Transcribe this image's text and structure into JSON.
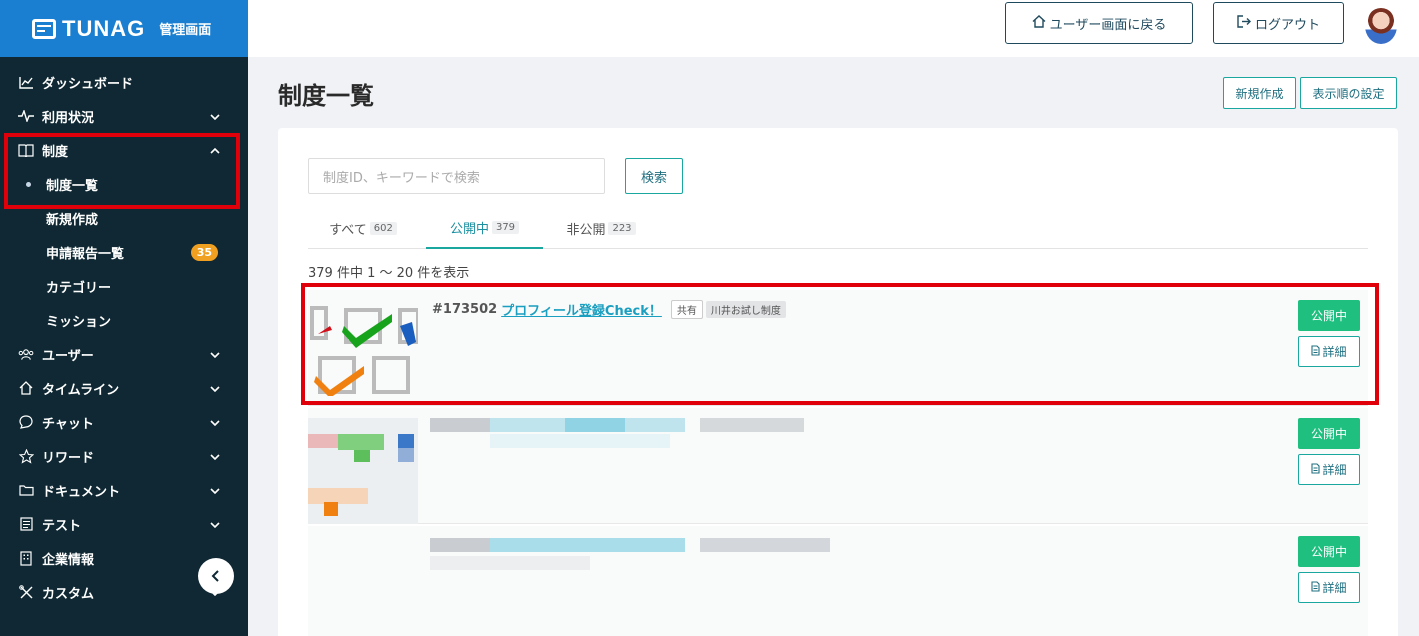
{
  "brand": {
    "name": "TUNAG",
    "sub": "管理画面"
  },
  "sidebar": {
    "items": [
      {
        "icon": "chart-icon",
        "glyph": "📈",
        "label": "ダッシュボード",
        "chevron": ""
      },
      {
        "icon": "activity-icon",
        "glyph": "∿",
        "label": "利用状況",
        "chevron": "⌄"
      },
      {
        "icon": "book-icon",
        "glyph": "📖",
        "label": "制度",
        "chevron": "⌃"
      }
    ],
    "sub_items": [
      {
        "label": "制度一覧",
        "active": true
      },
      {
        "label": "新規作成"
      },
      {
        "label": "申請報告一覧",
        "badge": "35"
      },
      {
        "label": "カテゴリー"
      },
      {
        "label": "ミッション"
      }
    ],
    "items_after": [
      {
        "icon": "users-icon",
        "glyph": "👥",
        "label": "ユーザー",
        "chevron": "⌄"
      },
      {
        "icon": "home-icon",
        "glyph": "⌂",
        "label": "タイムライン",
        "chevron": "⌄"
      },
      {
        "icon": "chat-icon",
        "glyph": "💬",
        "label": "チャット",
        "chevron": "⌄"
      },
      {
        "icon": "star-icon",
        "glyph": "☆",
        "label": "リワード",
        "chevron": "⌄"
      },
      {
        "icon": "folder-icon",
        "glyph": "🗀",
        "label": "ドキュメント",
        "chevron": "⌄"
      },
      {
        "icon": "test-icon",
        "glyph": "▤",
        "label": "テスト",
        "chevron": "⌄"
      },
      {
        "icon": "building-icon",
        "glyph": "▦",
        "label": "企業情報",
        "chevron": ""
      },
      {
        "icon": "tools-icon",
        "glyph": "✕",
        "label": "カスタム",
        "chevron": "⌄"
      }
    ],
    "collapse": "‹"
  },
  "header": {
    "back_label": "ユーザー画面に戻る",
    "logout_label": "ログアウト"
  },
  "page": {
    "title": "制度一覧",
    "new_label": "新規作成",
    "order_label": "表示順の設定"
  },
  "search": {
    "placeholder": "制度ID、キーワードで検索",
    "button": "検索"
  },
  "tabs": [
    {
      "label": "すべて",
      "count": "602"
    },
    {
      "label": "公開中",
      "count": "379"
    },
    {
      "label": "非公開",
      "count": "223"
    }
  ],
  "result_text": "379 件中 1 〜 20 件を表示",
  "rows": [
    {
      "id": "#173502",
      "title": "プロフィール登録Check！",
      "tags": [
        "共有",
        "川井お試し制度"
      ],
      "status": "公開中",
      "detail": "詳細"
    },
    {
      "status": "公開中",
      "detail": "詳細"
    },
    {
      "status": "公開中",
      "detail": "詳細"
    }
  ],
  "colors": {
    "sidebar_bg": "#0f2833",
    "brand_blue": "#1a7fd0",
    "accent_teal": "#1aa7a0",
    "status_green": "#1fbf7f",
    "highlight_red": "#e0000a"
  }
}
